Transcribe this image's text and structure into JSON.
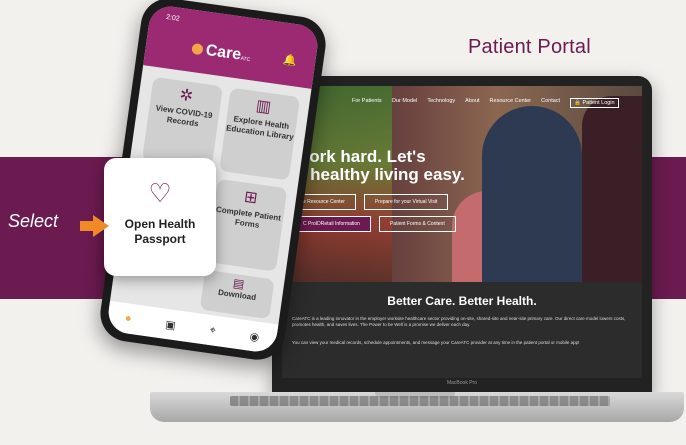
{
  "portal_title": "Patient Portal",
  "laptop": {
    "nav": [
      "For Patients",
      "Our Model",
      "Technology",
      "About",
      "Resource Center",
      "Contact"
    ],
    "login": "Patient Login",
    "headline_line1": "work hard. Let's",
    "headline_line2": "e healthy living easy.",
    "buttons": [
      "e Resource Center",
      "Prepare for your Virtual Visit",
      "C ProIDRetail Information",
      "Patient Forms & Content"
    ],
    "section_title": "Better Care. Better Health.",
    "para1": "CareATC is a leading innovator in the employer worksite healthcare sector providing on-site, shared-site and near-site primary care. Our direct care model lowers costs, promotes health, and saves lives. The Power to be Well is a promise we deliver each day.",
    "para2": "You can view your medical records, schedule appointments, and message your CareATC provider at any time in the patient portal or mobile app!",
    "brand_label": "MacBook Pro"
  },
  "phone": {
    "time": "2:02",
    "logo": "Care",
    "logo_suffix": "ATC",
    "tiles": {
      "covid": "View COVID-19 Records",
      "explore": "Explore Health Education Library",
      "complete": "Complete Patient Forms",
      "download": "Download"
    }
  },
  "zoom_card": {
    "label_line1": "Open Health",
    "label_line2": "Passport"
  },
  "select_label": "Select",
  "colors": {
    "brand_purple": "#6b1b4f",
    "phone_header": "#9b2a72",
    "accent_orange": "#f08a28"
  }
}
